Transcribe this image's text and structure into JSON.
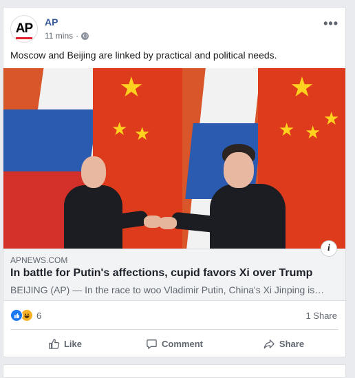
{
  "post": {
    "page_name": "AP",
    "avatar_text": "AP",
    "timestamp": "11 mins",
    "separator": "·",
    "text": "Moscow and Beijing are linked by practical and political needs."
  },
  "link": {
    "domain": "APNEWS.COM",
    "title": "In battle for Putin's affections, cupid favors Xi over Trump",
    "description": "BEIJING (AP) — In the race to woo Vladimir Putin, China's Xi Jinping is…",
    "info_glyph": "i"
  },
  "stats": {
    "reaction_count": "6",
    "shares": "1 Share"
  },
  "actions": {
    "like": "Like",
    "comment": "Comment",
    "share": "Share"
  },
  "icons": {
    "more": "more-options-icon",
    "privacy": "globe-icon",
    "like": "like-icon",
    "comment": "comment-icon",
    "share": "share-icon"
  },
  "colors": {
    "page_name": "#365899",
    "like_reaction": "#1877f2",
    "haha_reaction": "#f7b125"
  }
}
